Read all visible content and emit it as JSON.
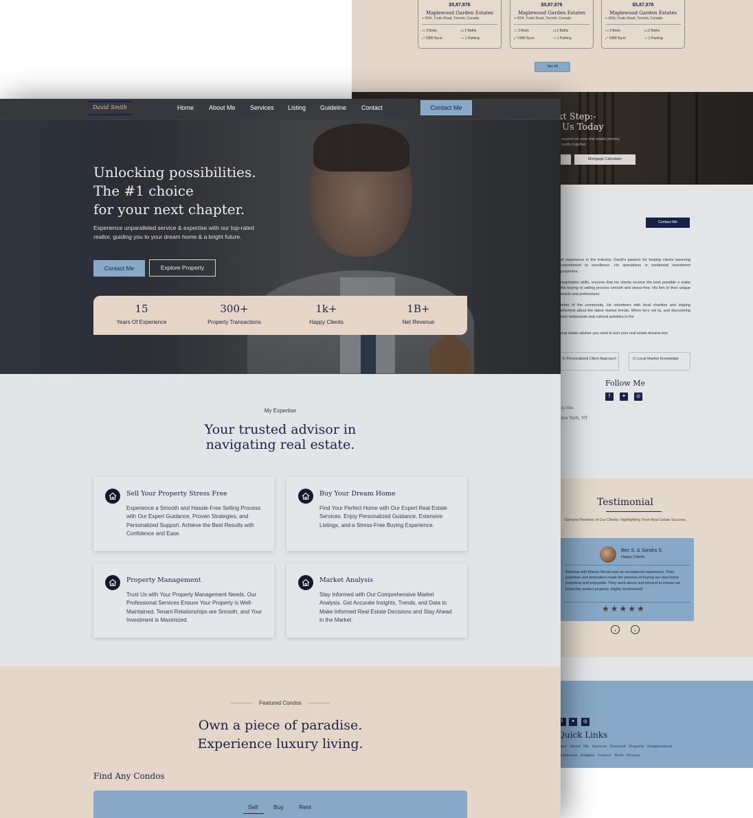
{
  "back": {
    "listings": [
      {
        "price": "$5,87,876",
        "name": "Maplewood Garden Estates",
        "address": "42/A, Trudo Road, Toronto, Canada",
        "beds": "3 Beds",
        "baths": "2 Baths",
        "area": "1980 Sq-m",
        "parking": "1 Parking"
      },
      {
        "price": "$5,87,876",
        "name": "Maplewood Garden Estates",
        "address": "42/A, Trudo Road, Toronto, Canada",
        "beds": "3 Beds",
        "baths": "2 Baths",
        "area": "1980 Sq-m",
        "parking": "1 Parking"
      },
      {
        "price": "$5,87,876",
        "name": "Maplewood Garden Estates",
        "address": "42/A, Trudo Road, Toronto, Canada",
        "beds": "3 Beds",
        "baths": "2 Baths",
        "area": "1980 Sq-m",
        "parking": "1 Parking"
      }
    ],
    "see_all": "See All",
    "cta": {
      "title_line1": "xt Step:-",
      "title_line2": "Us Today",
      "sub_line1": "d support on your real estate journey.",
      "sub_line2": "o reality together.",
      "calc_button": "Mortgage Calculator"
    },
    "about": {
      "contact_button": "Contact Me",
      "para1": "of experience in the industry. David's passion for helping clients wavering commitment to excellence. He specializes in residential investment properties.",
      "para2": "negotiation skills, ensures that his clients receive the best possible o make the buying or selling process smooth and stress-free. His llen to their unique needs and preferences.",
      "para3": "mber of the community. He volunteers with local charities and staying informed about the latest market trends. When he's not ily, and discovering new restaurants and cultural activities in the",
      "para4": "real estate advisor you need to turn your real estate dreams into",
      "chip1": "Personalized Client Approach",
      "chip2": "Local Market Knowledge",
      "follow": "Follow Me",
      "email": "lty.com",
      "city": "New York, NY"
    },
    "testimonial": {
      "title": "Testimonial",
      "subtitle": "Genuine Reviews of Our Clients: Highlighting Their Real Estate Success.",
      "name": "Ben S. & Sandra S.",
      "role": "Happy Clients",
      "quote": "Working with Mason Mount was an exceptional experience. Their expertise and dedication made the process of buying our new home seamless and enjoyable. They went above and beyond to ensure we found the perfect property. Highly recommend!",
      "stars": "★★★★★",
      "rating": 5,
      "prev": "‹",
      "next": "›"
    },
    "footer": {
      "quick_links": "Quick Links",
      "links_row1": "ome  About Me  Services  Featured Property  Neighborhood",
      "links_row2": "estimonial  Insights  Contact  Work Process"
    }
  },
  "nav": {
    "logo": "David Smith",
    "links": [
      "Home",
      "About Me",
      "Services",
      "Listing",
      "Guideline",
      "Contact"
    ],
    "contact_button": "Contact Me"
  },
  "hero": {
    "title_line1": "Unlocking possibilities.",
    "title_line2": "The #1 choice",
    "title_line3": "for your next chapter.",
    "subtitle": "Experience unparalleled service & expertise with our top-rated realtor, guiding you to your dream home & a bright future.",
    "primary_button": "Contact Me",
    "secondary_button": "Explore Property"
  },
  "stats": [
    {
      "value": "15",
      "label": "Years Of Experience"
    },
    {
      "value": "300+",
      "label": "Property Transactions"
    },
    {
      "value": "1k+",
      "label": "Happy Clients"
    },
    {
      "value": "1B+",
      "label": "Net Revenue"
    }
  ],
  "expertise": {
    "eyebrow": "My Expertise",
    "title_line1": "Your trusted advisor in",
    "title_line2": "navigating real estate.",
    "cards": [
      {
        "title": "Sell Your Property Stress Free",
        "desc": "Experience a Smooth and Hassle-Free Selling Process with Our Expert Guidance, Proven Strategies, and Personalized Support. Achieve the Best Results with Confidence and Ease.",
        "icon": "home-icon"
      },
      {
        "title": "Buy Your Dream Home",
        "desc": "Find Your Perfect Home with Our Expert Real Estate Services. Enjoy Personalized Guidance, Extensive Listings, and a Stress-Free Buying Experience.",
        "icon": "home-icon"
      },
      {
        "title": "Property Management",
        "desc": "Trust Us with Your Property Management Needs. Our Professional Services Ensure Your Property is Well-Maintained, Tenant Relationships are Smooth, and Your Investment is Maximized.",
        "icon": "home-icon"
      },
      {
        "title": "Market Analysis",
        "desc": "Stay Informed with Our Comprehensive Market Analysis. Get Accurate Insights, Trends, and Data to Make Informed Real Estate Decisions and Stay Ahead in the Market.",
        "icon": "home-icon"
      }
    ]
  },
  "condos": {
    "eyebrow": "Featured Condos",
    "title_line1": "Own a piece of paradise.",
    "title_line2": "Experience luxury living.",
    "find_title": "Find Any Condos",
    "tabs": [
      "Sell",
      "Buy",
      "Rent"
    ],
    "active_tab": "Sell"
  },
  "colors": {
    "navy": "#1b2340",
    "accent_blue": "#87a8c6",
    "beige": "#e4d6c9",
    "light_grey": "#e2e5e7"
  }
}
